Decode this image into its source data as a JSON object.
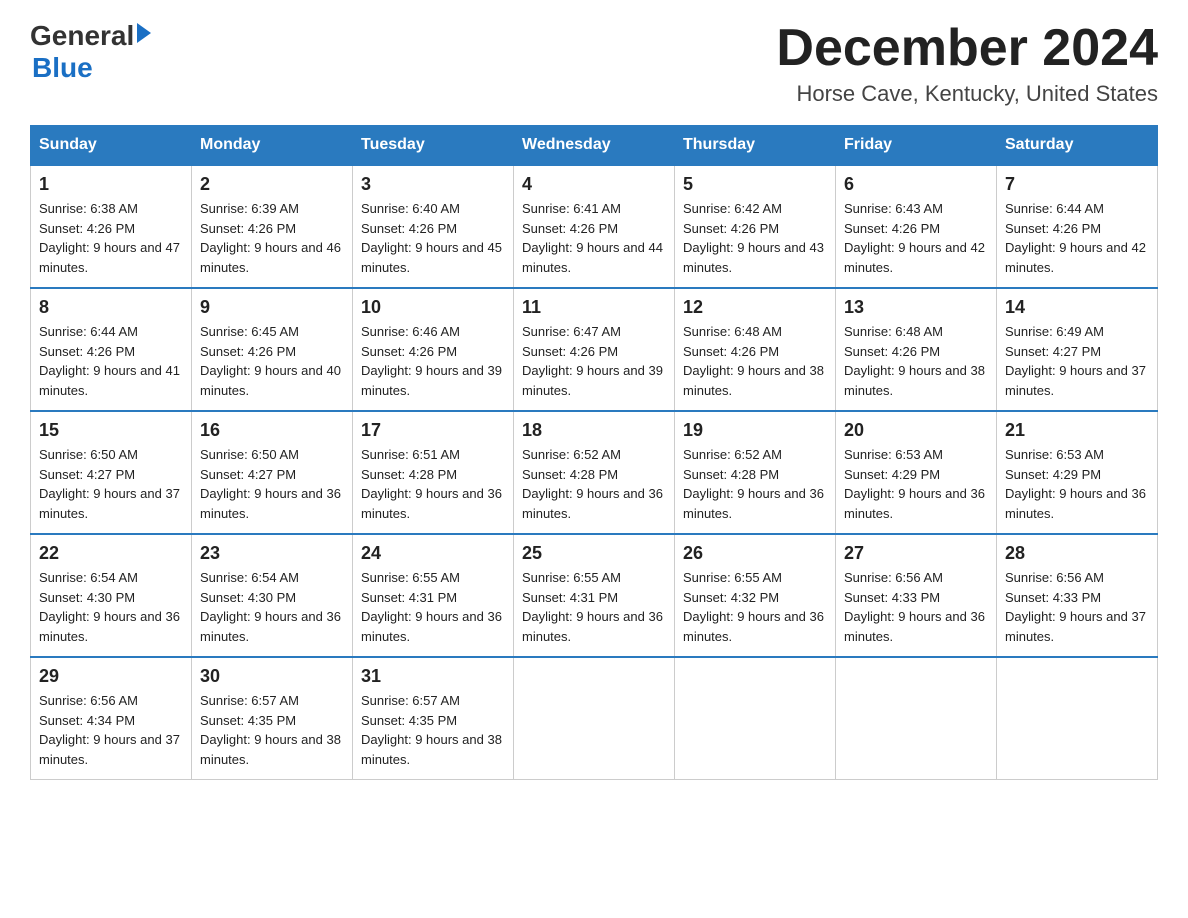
{
  "header": {
    "logo_general": "General",
    "logo_blue": "Blue",
    "month_title": "December 2024",
    "location": "Horse Cave, Kentucky, United States"
  },
  "weekdays": [
    "Sunday",
    "Monday",
    "Tuesday",
    "Wednesday",
    "Thursday",
    "Friday",
    "Saturday"
  ],
  "weeks": [
    [
      {
        "day": "1",
        "sunrise": "6:38 AM",
        "sunset": "4:26 PM",
        "daylight": "9 hours and 47 minutes."
      },
      {
        "day": "2",
        "sunrise": "6:39 AM",
        "sunset": "4:26 PM",
        "daylight": "9 hours and 46 minutes."
      },
      {
        "day": "3",
        "sunrise": "6:40 AM",
        "sunset": "4:26 PM",
        "daylight": "9 hours and 45 minutes."
      },
      {
        "day": "4",
        "sunrise": "6:41 AM",
        "sunset": "4:26 PM",
        "daylight": "9 hours and 44 minutes."
      },
      {
        "day": "5",
        "sunrise": "6:42 AM",
        "sunset": "4:26 PM",
        "daylight": "9 hours and 43 minutes."
      },
      {
        "day": "6",
        "sunrise": "6:43 AM",
        "sunset": "4:26 PM",
        "daylight": "9 hours and 42 minutes."
      },
      {
        "day": "7",
        "sunrise": "6:44 AM",
        "sunset": "4:26 PM",
        "daylight": "9 hours and 42 minutes."
      }
    ],
    [
      {
        "day": "8",
        "sunrise": "6:44 AM",
        "sunset": "4:26 PM",
        "daylight": "9 hours and 41 minutes."
      },
      {
        "day": "9",
        "sunrise": "6:45 AM",
        "sunset": "4:26 PM",
        "daylight": "9 hours and 40 minutes."
      },
      {
        "day": "10",
        "sunrise": "6:46 AM",
        "sunset": "4:26 PM",
        "daylight": "9 hours and 39 minutes."
      },
      {
        "day": "11",
        "sunrise": "6:47 AM",
        "sunset": "4:26 PM",
        "daylight": "9 hours and 39 minutes."
      },
      {
        "day": "12",
        "sunrise": "6:48 AM",
        "sunset": "4:26 PM",
        "daylight": "9 hours and 38 minutes."
      },
      {
        "day": "13",
        "sunrise": "6:48 AM",
        "sunset": "4:26 PM",
        "daylight": "9 hours and 38 minutes."
      },
      {
        "day": "14",
        "sunrise": "6:49 AM",
        "sunset": "4:27 PM",
        "daylight": "9 hours and 37 minutes."
      }
    ],
    [
      {
        "day": "15",
        "sunrise": "6:50 AM",
        "sunset": "4:27 PM",
        "daylight": "9 hours and 37 minutes."
      },
      {
        "day": "16",
        "sunrise": "6:50 AM",
        "sunset": "4:27 PM",
        "daylight": "9 hours and 36 minutes."
      },
      {
        "day": "17",
        "sunrise": "6:51 AM",
        "sunset": "4:28 PM",
        "daylight": "9 hours and 36 minutes."
      },
      {
        "day": "18",
        "sunrise": "6:52 AM",
        "sunset": "4:28 PM",
        "daylight": "9 hours and 36 minutes."
      },
      {
        "day": "19",
        "sunrise": "6:52 AM",
        "sunset": "4:28 PM",
        "daylight": "9 hours and 36 minutes."
      },
      {
        "day": "20",
        "sunrise": "6:53 AM",
        "sunset": "4:29 PM",
        "daylight": "9 hours and 36 minutes."
      },
      {
        "day": "21",
        "sunrise": "6:53 AM",
        "sunset": "4:29 PM",
        "daylight": "9 hours and 36 minutes."
      }
    ],
    [
      {
        "day": "22",
        "sunrise": "6:54 AM",
        "sunset": "4:30 PM",
        "daylight": "9 hours and 36 minutes."
      },
      {
        "day": "23",
        "sunrise": "6:54 AM",
        "sunset": "4:30 PM",
        "daylight": "9 hours and 36 minutes."
      },
      {
        "day": "24",
        "sunrise": "6:55 AM",
        "sunset": "4:31 PM",
        "daylight": "9 hours and 36 minutes."
      },
      {
        "day": "25",
        "sunrise": "6:55 AM",
        "sunset": "4:31 PM",
        "daylight": "9 hours and 36 minutes."
      },
      {
        "day": "26",
        "sunrise": "6:55 AM",
        "sunset": "4:32 PM",
        "daylight": "9 hours and 36 minutes."
      },
      {
        "day": "27",
        "sunrise": "6:56 AM",
        "sunset": "4:33 PM",
        "daylight": "9 hours and 36 minutes."
      },
      {
        "day": "28",
        "sunrise": "6:56 AM",
        "sunset": "4:33 PM",
        "daylight": "9 hours and 37 minutes."
      }
    ],
    [
      {
        "day": "29",
        "sunrise": "6:56 AM",
        "sunset": "4:34 PM",
        "daylight": "9 hours and 37 minutes."
      },
      {
        "day": "30",
        "sunrise": "6:57 AM",
        "sunset": "4:35 PM",
        "daylight": "9 hours and 38 minutes."
      },
      {
        "day": "31",
        "sunrise": "6:57 AM",
        "sunset": "4:35 PM",
        "daylight": "9 hours and 38 minutes."
      },
      null,
      null,
      null,
      null
    ]
  ]
}
